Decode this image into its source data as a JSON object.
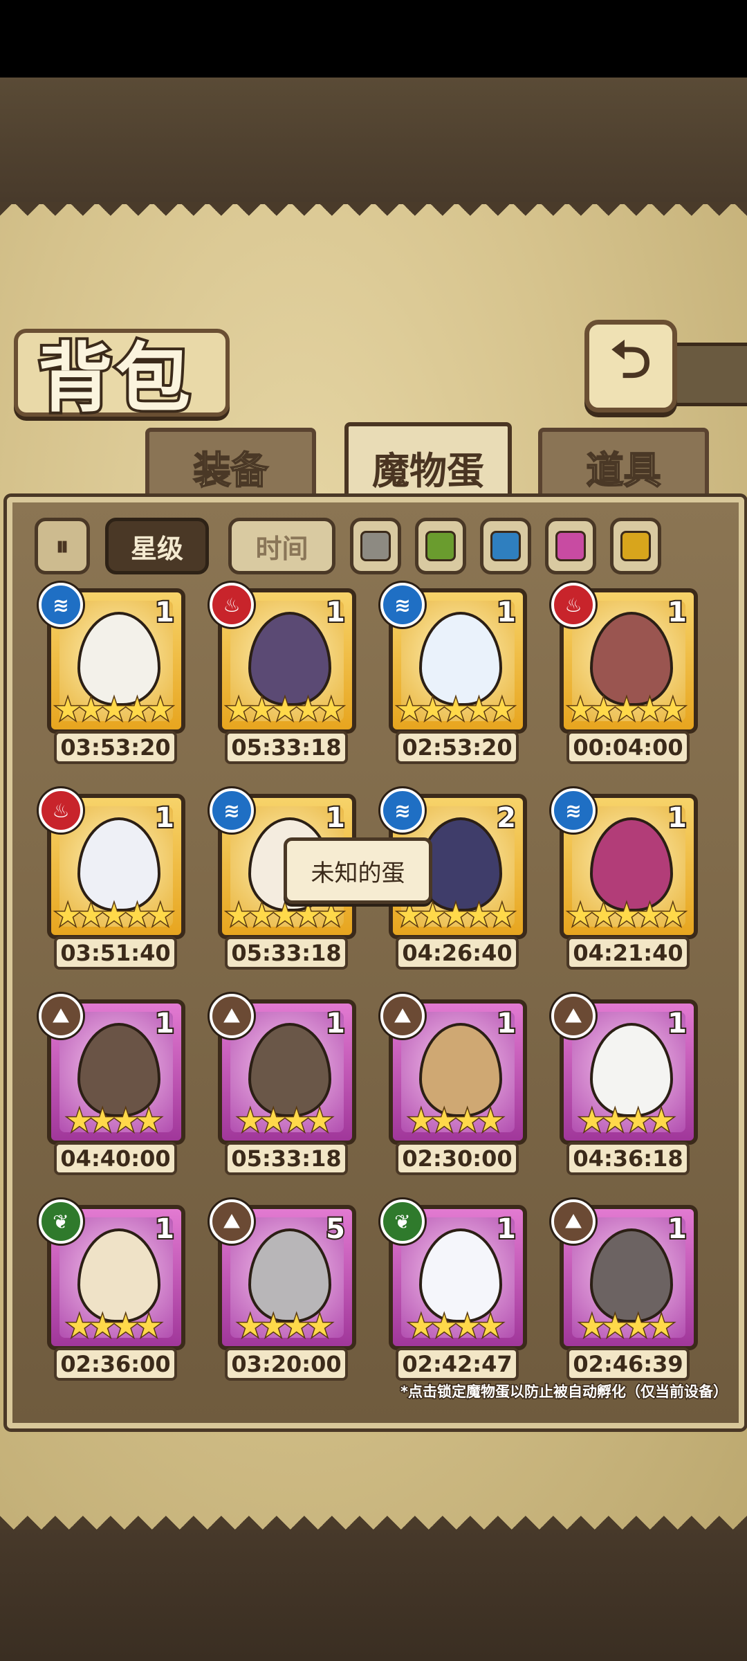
{
  "header": {
    "title": "背包",
    "back_icon": "back-arrow-icon"
  },
  "tabs": [
    {
      "label": "装备",
      "active": false
    },
    {
      "label": "魔物蛋",
      "active": true
    },
    {
      "label": "道具",
      "active": false
    }
  ],
  "filters": {
    "filter_icon": "filter-toggle-icon",
    "sort_star": "星级",
    "sort_time": "时间",
    "colors": [
      "#8d8a82",
      "#6a9c2e",
      "#2f7fbf",
      "#c84ba2",
      "#d8a51c"
    ]
  },
  "tooltip": "未知的蛋",
  "footer_note": "*点击锁定魔物蛋以防止被自动孵化（仅当前设备）",
  "eggs": [
    {
      "element": "water",
      "element_color": "#1f6fc4",
      "count": "1",
      "stars": "★★★★★",
      "time": "03:53:20",
      "frame": "gold",
      "egg_color": "#f3f1ea"
    },
    {
      "element": "fire",
      "element_color": "#c8242b",
      "count": "1",
      "stars": "★★★★★",
      "time": "05:33:18",
      "frame": "gold",
      "egg_color": "#5b4a74"
    },
    {
      "element": "water",
      "element_color": "#1f6fc4",
      "count": "1",
      "stars": "★★★★★",
      "time": "02:53:20",
      "frame": "gold",
      "egg_color": "#eaf2fb"
    },
    {
      "element": "fire",
      "element_color": "#c8242b",
      "count": "1",
      "stars": "★★★★★",
      "time": "00:04:00",
      "frame": "gold",
      "egg_color": "#9a5550"
    },
    {
      "element": "fire",
      "element_color": "#c8242b",
      "count": "1",
      "stars": "★★★★★",
      "time": "03:51:40",
      "frame": "gold",
      "egg_color": "#eef0f6"
    },
    {
      "element": "water",
      "element_color": "#1f6fc4",
      "count": "1",
      "stars": "★★★★★",
      "time": "05:33:18",
      "frame": "gold",
      "egg_color": "#f4ecdf"
    },
    {
      "element": "water",
      "element_color": "#1f6fc4",
      "count": "2",
      "stars": "★★★★★",
      "time": "04:26:40",
      "frame": "gold",
      "egg_color": "#3f3d6a"
    },
    {
      "element": "water",
      "element_color": "#1f6fc4",
      "count": "1",
      "stars": "★★★★★",
      "time": "04:21:40",
      "frame": "gold",
      "egg_color": "#b23d78"
    },
    {
      "element": "earth",
      "element_color": "#6b4a34",
      "count": "1",
      "stars": "★★★★",
      "time": "04:40:00",
      "frame": "pink",
      "egg_color": "#6a5446"
    },
    {
      "element": "earth",
      "element_color": "#6b4a34",
      "count": "1",
      "stars": "★★★★",
      "time": "05:33:18",
      "frame": "pink",
      "egg_color": "#6a5748"
    },
    {
      "element": "earth",
      "element_color": "#6b4a34",
      "count": "1",
      "stars": "★★★★",
      "time": "02:30:00",
      "frame": "pink",
      "egg_color": "#cfa873"
    },
    {
      "element": "earth",
      "element_color": "#6b4a34",
      "count": "1",
      "stars": "★★★★",
      "time": "04:36:18",
      "frame": "pink",
      "egg_color": "#f4f4f2"
    },
    {
      "element": "wood",
      "element_color": "#2f7a2c",
      "count": "1",
      "stars": "★★★★",
      "time": "02:36:00",
      "frame": "pink",
      "egg_color": "#efe2c7"
    },
    {
      "element": "earth",
      "element_color": "#6b4a34",
      "count": "5",
      "stars": "★★★★",
      "time": "03:20:00",
      "frame": "pink",
      "egg_color": "#b8b6b8"
    },
    {
      "element": "wood",
      "element_color": "#2f7a2c",
      "count": "1",
      "stars": "★★★★",
      "time": "02:42:47",
      "frame": "pink",
      "egg_color": "#f5f6fb"
    },
    {
      "element": "earth",
      "element_color": "#6b4a34",
      "count": "1",
      "stars": "★★★★",
      "time": "02:46:39",
      "frame": "pink",
      "egg_color": "#6c6362"
    }
  ]
}
